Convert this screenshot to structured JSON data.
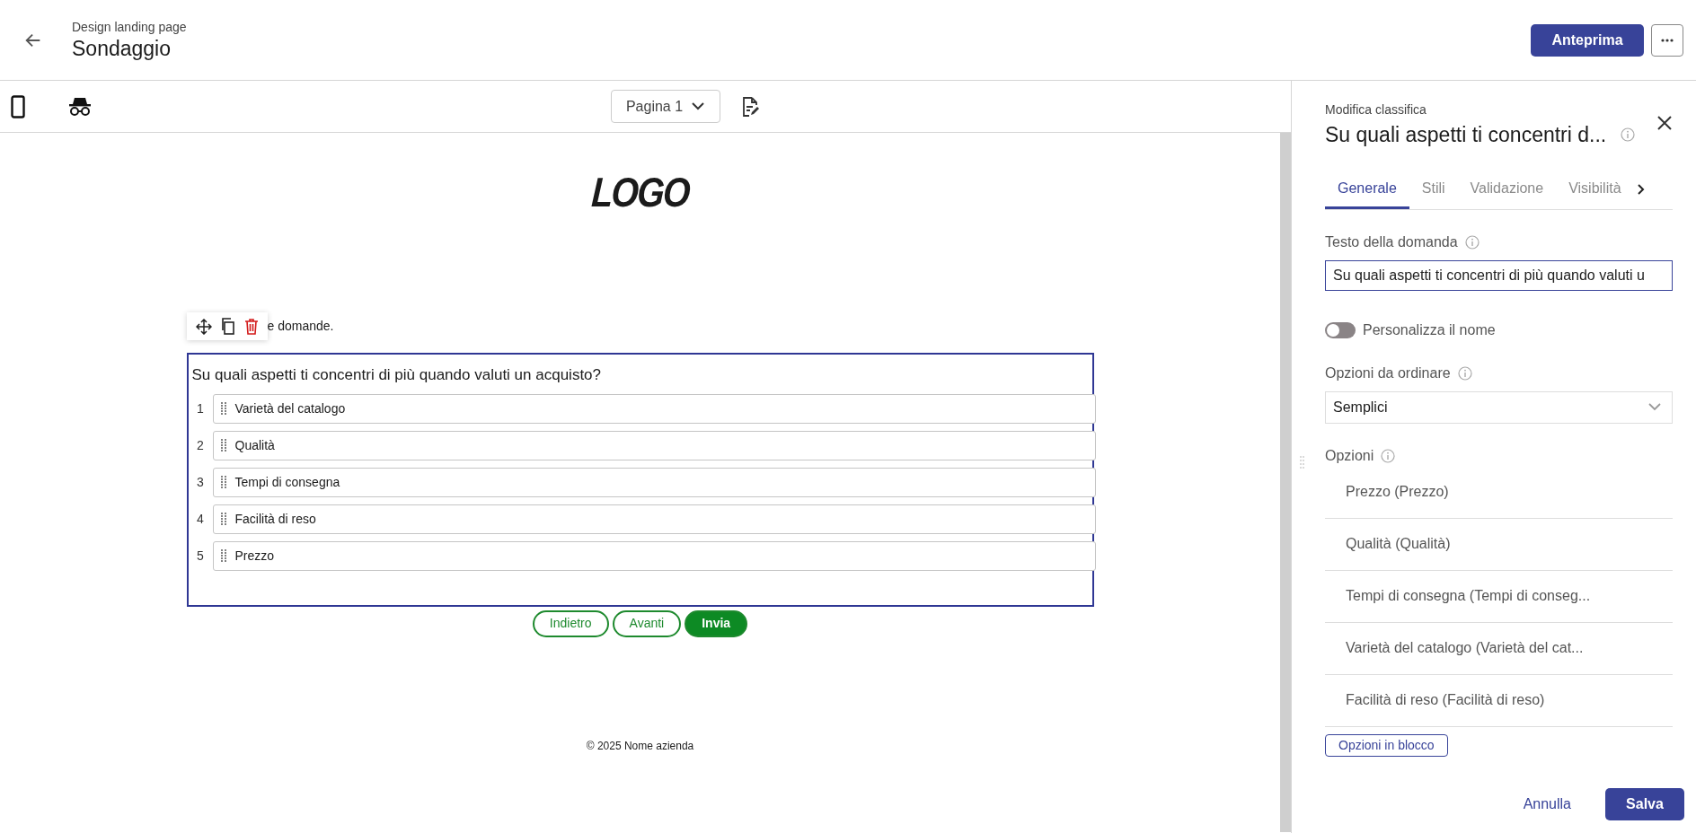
{
  "header": {
    "subtitle": "Design landing page",
    "title": "Sondaggio",
    "preview_button": "Anteprima"
  },
  "toolbar": {
    "page_select": "Pagina 1"
  },
  "canvas": {
    "logo": "LOGO",
    "intro_text": "e domande.",
    "question": {
      "title": "Su quali aspetti ti concentri di più quando valuti un acquisto?",
      "options": [
        {
          "number": "1",
          "label": "Varietà del catalogo"
        },
        {
          "number": "2",
          "label": "Qualità"
        },
        {
          "number": "3",
          "label": "Tempi di consegna"
        },
        {
          "number": "4",
          "label": "Facilità di reso"
        },
        {
          "number": "5",
          "label": "Prezzo"
        }
      ]
    },
    "nav_buttons": [
      {
        "label": "Indietro",
        "kind": "outline"
      },
      {
        "label": "Avanti",
        "kind": "outline"
      },
      {
        "label": "Invia",
        "kind": "filled"
      }
    ],
    "footer": "© 2025 Nome azienda"
  },
  "panel": {
    "caption": "Modifica classifica",
    "title": "Su quali aspetti ti concentri d...",
    "tabs": [
      {
        "label": "Generale",
        "selected": true
      },
      {
        "label": "Stili",
        "selected": false
      },
      {
        "label": "Validazione",
        "selected": false
      },
      {
        "label": "Visibilità",
        "selected": false
      }
    ],
    "question_label": "Testo della domanda",
    "question_value": "Su quali aspetti ti concentri di più quando valuti u",
    "toggle": {
      "label": "Personalizza il nome",
      "on": false
    },
    "order_label": "Opzioni da ordinare",
    "order_value": "Semplici",
    "options_label": "Opzioni",
    "options": [
      "Prezzo (Prezzo)",
      "Qualità (Qualità)",
      "Tempi di consegna (Tempi di conseg...",
      "Varietà del catalogo (Varietà del cat...",
      "Facilità di reso (Facilità di reso)"
    ],
    "bulk_button": "Opzioni in blocco",
    "cancel_button": "Annulla",
    "save_button": "Salva"
  }
}
